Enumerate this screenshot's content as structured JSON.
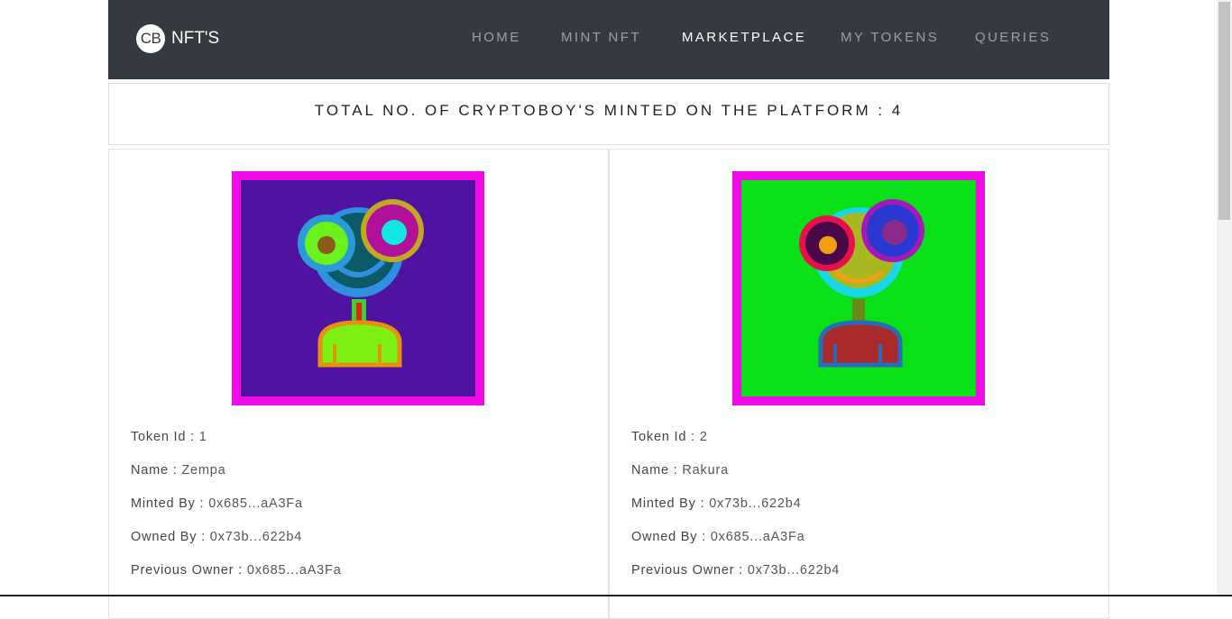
{
  "brand": {
    "logo_text": "CB",
    "name": "NFT'S"
  },
  "nav": {
    "items": [
      {
        "label": "HOME",
        "active": false
      },
      {
        "label": "MINT NFT",
        "active": false
      },
      {
        "label": "MARKETPLACE",
        "active": true
      },
      {
        "label": "MY TOKENS",
        "active": false
      },
      {
        "label": "QUERIES",
        "active": false
      }
    ]
  },
  "total": {
    "text": "TOTAL NO. OF CRYPTOBOY'S MINTED ON THE PLATFORM : 4"
  },
  "tokens": [
    {
      "token_id_label": "Token Id :",
      "token_id": "1",
      "name_label": "Name :",
      "name": "Zempa",
      "minted_by_label": "Minted By :",
      "minted_by": "0x685...aA3Fa",
      "owned_by_label": "Owned By :",
      "owned_by": "0x73b...622b4",
      "previous_owner_label": "Previous Owner :",
      "previous_owner": "0x685...aA3Fa",
      "colors": {
        "border": "#f00ce8",
        "background": "#5012a0",
        "head_ring": "#2f8fe0",
        "face": "#0c5a68",
        "eye_left_ring": "#2a9bd8",
        "eye_left": "#6bf21c",
        "eye_left_pupil": "#8a5a1a",
        "eye_right_ring": "#c2a81e",
        "eye_right": "#b0109a",
        "eye_right_pupil": "#0ee8e0",
        "neck": "#3ad23a",
        "neck_inner": "#e82010",
        "body": "#7cf012",
        "body_outline": "#e8900e"
      }
    },
    {
      "token_id_label": "Token Id :",
      "token_id": "2",
      "name_label": "Name :",
      "name": "Rakura",
      "minted_by_label": "Minted By :",
      "minted_by": "0x73b...622b4",
      "owned_by_label": "Owned By :",
      "owned_by": "0x685...aA3Fa",
      "previous_owner_label": "Previous Owner :",
      "previous_owner": "0x73b...622b4",
      "colors": {
        "border": "#f00ce8",
        "background": "#08e018",
        "head_ring": "#18d8e8",
        "face": "#a8b820",
        "eye_left_ring": "#e8104a",
        "eye_left": "#4a0a4a",
        "eye_left_pupil": "#f0a010",
        "eye_right_ring": "#a818b8",
        "eye_right": "#2838d0",
        "eye_right_pupil": "#8a2a8a",
        "neck": "#6a8a18",
        "neck_inner": "#6a8a18",
        "body": "#a82a2a",
        "body_outline": "#2a6ab8",
        "mouth": "#f0a010"
      }
    }
  ]
}
